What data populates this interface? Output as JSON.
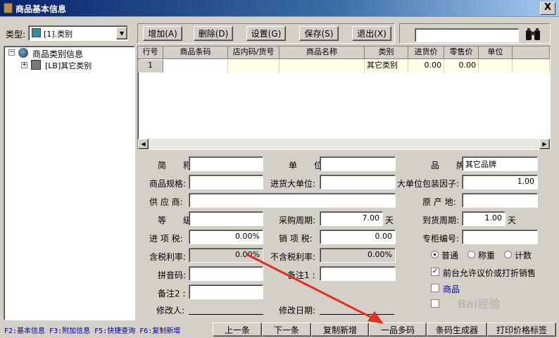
{
  "window": {
    "title": "商品基本信息",
    "close": "X"
  },
  "type": {
    "label": "类型:",
    "value": "[1].类别"
  },
  "toolbar": {
    "add": "增加(A)",
    "delete": "删除(D)",
    "settings": "设置(G)",
    "save": "保存(S)",
    "exit": "退出(X)",
    "search_placeholder": ""
  },
  "tree": {
    "root": "商品类别信息",
    "child": "[LB]其它类别"
  },
  "grid": {
    "headers": [
      "行号",
      "商品条码",
      "店内码/货号",
      "商品名称",
      "类别",
      "进货价",
      "零售价",
      "单位"
    ],
    "rows": [
      {
        "no": "1",
        "barcode": "",
        "code": "",
        "name": "",
        "category": "其它类别",
        "buy": "0.00",
        "sell": "0.00",
        "unit": ""
      }
    ]
  },
  "form": {
    "short_name": {
      "label": "简　　称:",
      "value": ""
    },
    "unit": {
      "label": "单　　位:",
      "value": ""
    },
    "brand": {
      "label": "品　　牌:",
      "value": "其它品牌"
    },
    "spec": {
      "label": "商品规格:",
      "value": ""
    },
    "buy_big_unit": {
      "label": "进货大单位:",
      "value": ""
    },
    "pack_factor": {
      "label": "大单位包装因子:",
      "value": "1.00"
    },
    "supplier": {
      "label": "供 应 商:",
      "value": ""
    },
    "origin": {
      "label": "原 产 地:",
      "value": ""
    },
    "grade": {
      "label": "等　　级:",
      "value": ""
    },
    "purchase_cycle": {
      "label": "采购周期:",
      "value": "7.00",
      "suffix": "天"
    },
    "arrival_cycle": {
      "label": "到货周期:",
      "value": "1.00",
      "suffix": "天"
    },
    "input_tax": {
      "label": "进 项 税:",
      "value": "0.00%"
    },
    "output_tax": {
      "label": "销 项 税:",
      "value": "0.00"
    },
    "counter_no": {
      "label": "专柜编号:",
      "value": ""
    },
    "tax_margin": {
      "label": "含税利率:",
      "value": "0.00%"
    },
    "notax_margin": {
      "label": "不含税利率:",
      "value": "0.00%"
    },
    "pinyin": {
      "label": "拼音码:",
      "value": ""
    },
    "note1": {
      "label": "备注1 :",
      "value": ""
    },
    "note2": {
      "label": "备注2 :",
      "value": ""
    },
    "modifier": {
      "label": "修改人:"
    },
    "modified_date": {
      "label": "修改日期:"
    },
    "radio_normal": "普通",
    "radio_weight": "称重",
    "radio_count": "计数",
    "allow_discount": "前台允许议价或打折销售",
    "goods_flag": "商品"
  },
  "statusbar": {
    "hints": "F2:基本信息 F3:附加信息 F5:快捷查询 F6:复制新增",
    "prev": "上一条",
    "next": "下一条",
    "copy_new": "复制新增",
    "multi_code": "一品多码",
    "barcode_gen": "条码生成器",
    "print_label": "打印价格标签"
  },
  "watermark": "Bai经验",
  "colors": {
    "title_start": "#0a246a",
    "arrow": "#e03020",
    "hint_text": "#0000a0"
  }
}
